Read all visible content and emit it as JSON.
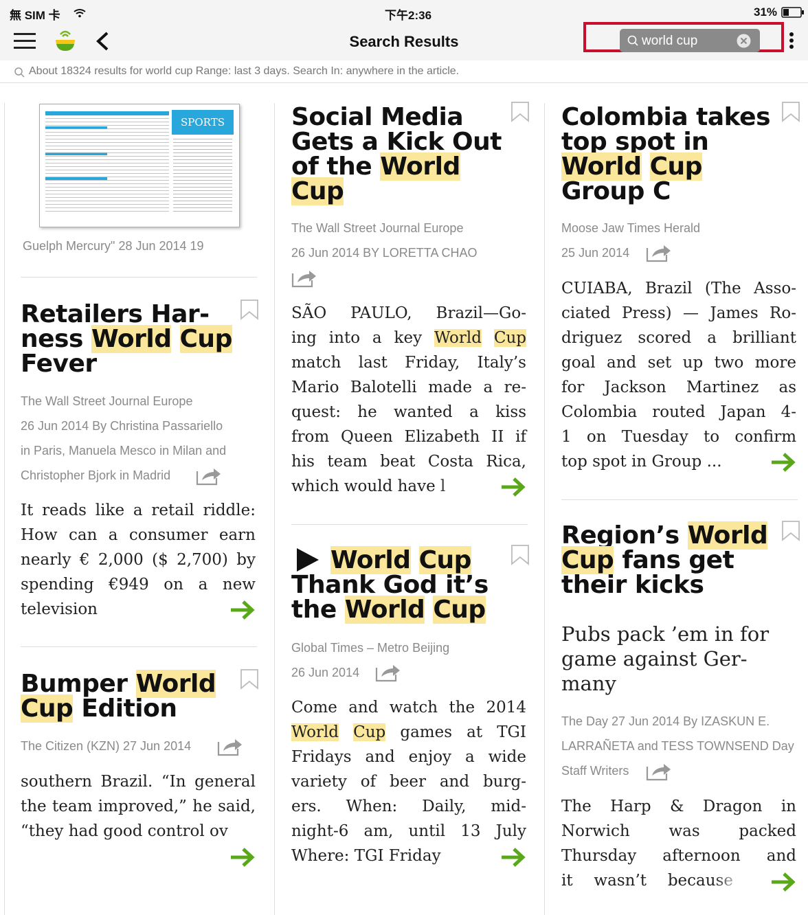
{
  "status": {
    "carrier": "無 SIM 卡",
    "time": "下午2:36",
    "battery": "31%"
  },
  "nav": {
    "title": "Search Results",
    "search_value": "world cup"
  },
  "summary": "About 18324 results for world cup Range: last 3 days. Search In: anywhere in the article.",
  "col1": {
    "thumb": {
      "banner": "SPORTS",
      "meta": "Guelph Mercury\"  28 Jun 2014  19"
    },
    "a2": {
      "t1": "Retailers Har-",
      "t2a": "ness ",
      "t2b": "World",
      "t2c": "Cup",
      "t3": "Fever",
      "source": "The Wall Street Journal Europe",
      "m1": "26 Jun 2014   By Christina Passariello",
      "m2": "in Paris, Manuela Mesco in Milan and",
      "m3": "Christopher Bjork in Madrid",
      "body": "It reads like a retail riddle: How can a consumer earn nearly € 2,000 ($ 2,700) by spending €949 on a new television"
    },
    "a3": {
      "t1a": "Bumper ",
      "t1b": "World",
      "t2a": "Cup",
      "t2b": " Edition",
      "meta": "The Citizen (KZN)   27 Jun 2014",
      "body": "southern Brazil. “In general the team improved,” he said, “they had good control ov"
    }
  },
  "col2": {
    "a1": {
      "t1": "Social Media",
      "t2": "Gets a Kick Out",
      "t3a": "of the ",
      "t3b": "World",
      "t4": "Cup",
      "source": "The Wall Street Journal Europe",
      "meta": "26 Jun 2014   BY LORETTA CHAO",
      "b1": "SÃO PAULO, Brazil—Go-",
      "b2a": "ing into a key ",
      "b2b": "World",
      "b2c": "Cup",
      "b3": "match last Friday, Italy’s",
      "b4": "Mario Balotelli made a re-",
      "b5": "quest: he wanted a kiss",
      "b6": "from Queen Elizabeth II if",
      "b7": "his team beat Costa Rica,",
      "b8": "which would have l"
    },
    "a2": {
      "t1a": "World",
      "t1b": "Cup",
      "t2": "Thank God it’s",
      "t3a": "the ",
      "t3b": "World",
      "t3c": "Cup",
      "source": "Global Times – Metro Beijing",
      "meta": "26 Jun 2014",
      "b1": "Come and watch the 2014",
      "b2a": "World",
      "b2b": "Cup",
      "b2c": " games at TGI",
      "b3": "Fridays and enjoy a wide",
      "b4": "variety of beer and burg-",
      "b5": "ers. When: Daily, mid-",
      "b6": "night-6 am, until 13 July",
      "b7": "Where: TGI Friday"
    }
  },
  "col3": {
    "a1": {
      "t1": "Colombia takes",
      "t2": "top spot in",
      "t3a": "World",
      "t3b": "Cup",
      "t4": "Group C",
      "source": "Moose Jaw Times Herald",
      "meta": "25 Jun 2014",
      "b1": "CUIABA, Brazil (The Asso-",
      "b2": "ciated Press) — James Ro-",
      "b3": "driguez scored a brilliant",
      "b4": "goal and set up two more",
      "b5": "for Jackson Martinez as",
      "b6": "Colombia routed Japan 4-",
      "b7": "1 on Tuesday to confirm",
      "b8": "top spot in Group ..."
    },
    "a2": {
      "t1a": "Region’s ",
      "t1b": "World",
      "t2a": "Cup",
      "t2b": " fans get",
      "t3": "their kicks",
      "deck1": "Pubs pack ’em in for",
      "deck2": "game against Ger-",
      "deck3": "many",
      "m1": "The Day   27 Jun 2014   By IZASKUN E.",
      "m2": "LARRAÑETA and TESS TOWNSEND Day",
      "m3": "Staff Writers",
      "b1": "The Harp & Dragon in",
      "b2": "Norwich was packed",
      "b3": "Thursday afternoon and",
      "b4": "it wasn’t because"
    }
  }
}
